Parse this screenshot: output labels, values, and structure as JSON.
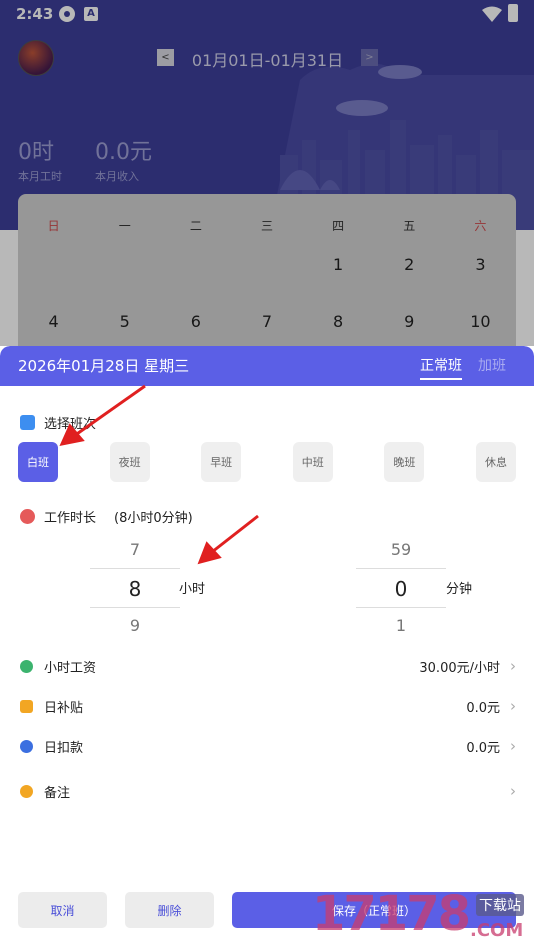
{
  "status_bar": {
    "time": "2:43"
  },
  "header": {
    "period_prev": "<",
    "period": "01月01日-01月31日",
    "period_next": ">",
    "stats": [
      {
        "value": "0时",
        "label": "本月工时"
      },
      {
        "value": "0.0元",
        "label": "本月收入"
      }
    ]
  },
  "calendar": {
    "weekdays": [
      "日",
      "一",
      "二",
      "三",
      "四",
      "五",
      "六"
    ],
    "rows": [
      [
        "",
        "",
        "",
        "",
        "1",
        "2",
        "3"
      ],
      [
        "4",
        "5",
        "6",
        "7",
        "8",
        "9",
        "10"
      ]
    ]
  },
  "sheet": {
    "date": "2026年01月28日 星期三",
    "tabs": [
      "正常班",
      "加班"
    ],
    "shift_title": "选择班次",
    "shifts": [
      "白班",
      "夜班",
      "早班",
      "中班",
      "晚班",
      "休息"
    ],
    "active_shift": 0,
    "work_title": "工作时长",
    "work_summary": "(8小时0分钟)",
    "hours_picker": {
      "prev": "7",
      "current": "8",
      "next": "9",
      "unit": "小时"
    },
    "minutes_picker": {
      "prev": "59",
      "current": "0",
      "next": "1",
      "unit": "分钟"
    },
    "rows": [
      {
        "label": "小时工资",
        "value": "30.00元/小时"
      },
      {
        "label": "日补贴",
        "value": "0.0元"
      },
      {
        "label": "日扣款",
        "value": "0.0元"
      },
      {
        "label": "备注",
        "value": ""
      }
    ],
    "buttons": {
      "cancel": "取消",
      "delete": "删除",
      "save": "保存（正常班）"
    }
  },
  "watermark": {
    "number": "17178",
    "sub": "下载站",
    "domain": ".COM"
  },
  "colors": {
    "header_bg": "#3e3f9a",
    "accent": "#5b5fe6",
    "arrow": "#e02020"
  }
}
